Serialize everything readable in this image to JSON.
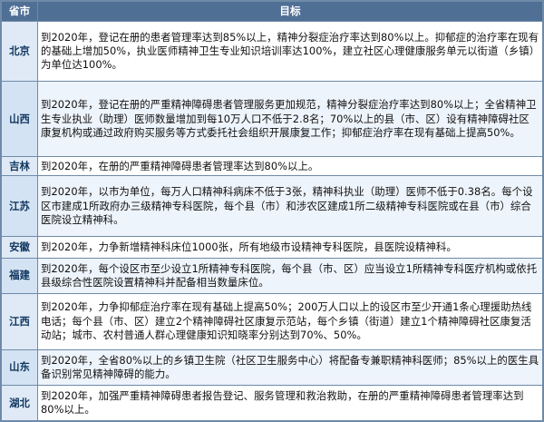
{
  "header": {
    "col_province": "省市",
    "col_goal": "目标"
  },
  "rows": [
    {
      "province": "北京",
      "goal": "到2020年，登记在册的患者管理率达到85%以上，精神分裂症治疗率达到80%以上。抑郁症的治疗率在现有的基础上增加50%，执业医师精神卫生专业知识培训率达100%，建立社区心理健康服务单元以街道（乡镇）为单位达100%。"
    },
    {
      "province": "山西",
      "goal": "到2020年，登记在册的严重精神障碍患者管理服务更加规范，精神分裂症治疗率达到80%以上；全省精神卫生专业执业（助理）医师数量增加到每10万人口不低于2.8名；70%以上的县（市、区）设有精神障碍社区康复机构或通过政府购买服务等方式委托社会组织开展康复工作；抑郁症治疗率在现有基础上提高50%。"
    },
    {
      "province": "吉林",
      "goal": "到2020年，在册的严重精神障碍患者管理率达到80%以上。"
    },
    {
      "province": "江苏",
      "goal": "到2020年，以市为单位，每万人口精神科病床不低于3张，精神科执业（助理）医师不低于0.38名。每个设区市建成1所政府办三级精神专科医院，每个县（市）和涉农区建成1所二级精神专科医院或在县（市）综合医院设立精神科。"
    },
    {
      "province": "安徽",
      "goal": "到2020年，力争新增精神科床位1000张，所有地级市设精神专科医院，县医院设精神科。"
    },
    {
      "province": "福建",
      "goal": "到2020年，每个设区市至少设立1所精神专科医院，每个县（市、区）应当设立1所精神专科医疗机构或依托县级综合性医院设置精神科并配备相当数量床位。"
    },
    {
      "province": "江西",
      "goal": "到2020年，力争抑郁症治疗率在现有基础上提高50%；200万人口以上的设区市至少开通1条心理援助热线电话；每个县（市、区）建立2个精神障碍社区康复示范站，每个乡镇（街道）建立1个精神障碍社区康复活动站；城市、农村普通人群心理健康知识知晓率分别达到70%、50%。"
    },
    {
      "province": "山东",
      "goal": "到2020年，全省80%以上的乡镇卫生院（社区卫生服务中心）将配备专兼职精神科医师；85%以上的医生具备识别常见精神障碍的能力。"
    },
    {
      "province": "湖北",
      "goal": "到2020年，加强严重精神障碍患者报告登记、服务管理和救治救助，在册的严重精神障碍患者管理率达到80%以上。"
    }
  ]
}
